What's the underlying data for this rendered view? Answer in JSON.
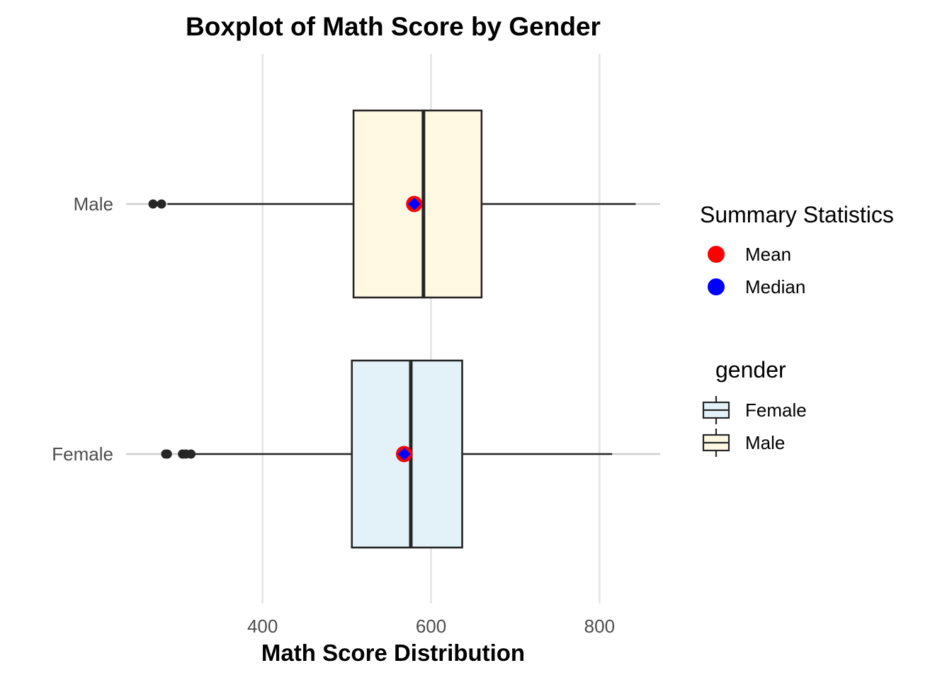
{
  "chart_data": {
    "type": "boxplot",
    "title": "Boxplot of Math Score by Gender",
    "xlabel": "Math Score Distribution",
    "ylabel": "",
    "orientation": "horizontal",
    "xlim": [
      238,
      872
    ],
    "xticks": [
      400,
      600,
      800
    ],
    "grid": "vertical major",
    "categories": [
      "Male",
      "Female"
    ],
    "boxes": [
      {
        "name": "Male",
        "fill": "#FFF8E3",
        "whisker_low": 287,
        "q1": 508,
        "median": 591,
        "q3": 660,
        "whisker_high": 843,
        "mean": 580,
        "outliers": [
          270,
          280
        ]
      },
      {
        "name": "Female",
        "fill": "#E3F1F9",
        "whisker_low": 320,
        "q1": 506,
        "median": 576,
        "q3": 637,
        "whisker_high": 815,
        "mean": 568,
        "outliers": [
          285,
          287,
          305,
          309,
          315
        ]
      }
    ],
    "legends": [
      {
        "title": "Summary Statistics",
        "placement": "right",
        "items": [
          {
            "label": "Mean",
            "color": "#FF0000",
            "shape": "circle"
          },
          {
            "label": "Median",
            "color": "#0000FF",
            "shape": "circle"
          }
        ]
      },
      {
        "title": "gender",
        "placement": "right",
        "items": [
          {
            "label": "Female",
            "color": "#E3F1F9",
            "shape": "box"
          },
          {
            "label": "Male",
            "color": "#FFF8E3",
            "shape": "box"
          }
        ]
      }
    ]
  }
}
